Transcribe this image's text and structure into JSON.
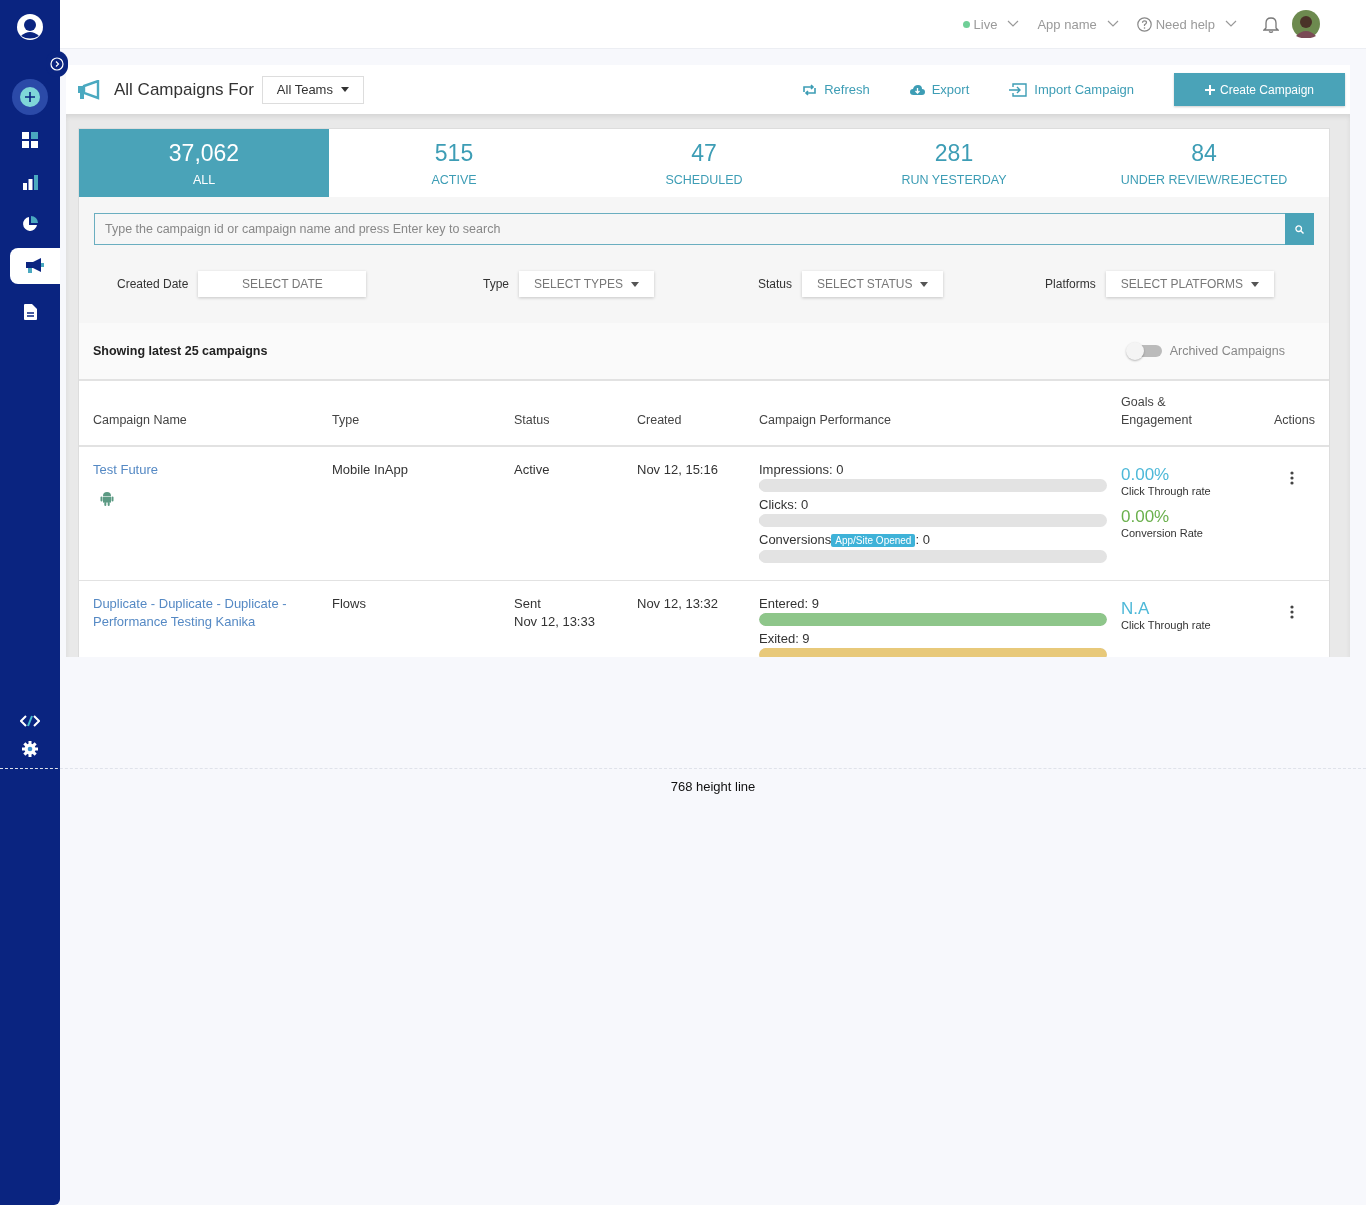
{
  "sidebar": {
    "items": [
      {
        "kind": "create",
        "selected": false
      },
      {
        "kind": "dashboard",
        "selected": false
      },
      {
        "kind": "analytics",
        "selected": false
      },
      {
        "kind": "segments",
        "selected": false
      },
      {
        "kind": "campaigns",
        "selected": true
      },
      {
        "kind": "reports",
        "selected": false
      }
    ],
    "bottom_items": [
      {
        "kind": "code"
      },
      {
        "kind": "settings"
      }
    ]
  },
  "header": {
    "environment": {
      "label": "Live",
      "color": "#6fcf97"
    },
    "app_name": "App name",
    "help": "Need help"
  },
  "title_bar": {
    "title": "All Campaigns For",
    "team_select": "All Teams",
    "actions": [
      {
        "kind": "refresh",
        "label": "Refresh"
      },
      {
        "kind": "export",
        "label": "Export"
      },
      {
        "kind": "import",
        "label": "Import Campaign"
      }
    ],
    "create_button": "Create Campaign"
  },
  "stats": [
    {
      "value": "37,062",
      "label": "ALL",
      "selected": true
    },
    {
      "value": "515",
      "label": "ACTIVE",
      "selected": false
    },
    {
      "value": "47",
      "label": "SCHEDULED",
      "selected": false
    },
    {
      "value": "281",
      "label": "RUN YESTERDAY",
      "selected": false
    },
    {
      "value": "84",
      "label": "UNDER REVIEW/REJECTED",
      "selected": false
    }
  ],
  "search": {
    "placeholder": "Type the campaign id or campaign name and press Enter key to search"
  },
  "filters": [
    {
      "label": "Created Date",
      "value": "SELECT DATE",
      "kind": "date"
    },
    {
      "label": "Type",
      "value": "SELECT TYPES",
      "kind": "dropdown"
    },
    {
      "label": "Status",
      "value": "SELECT STATUS",
      "kind": "dropdown"
    },
    {
      "label": "Platforms",
      "value": "SELECT PLATFORMS",
      "kind": "dropdown"
    }
  ],
  "summary": "Showing latest 25 campaigns",
  "archived_toggle": {
    "label": "Archived Campaigns",
    "on": false
  },
  "table": {
    "columns": [
      "Campaign Name",
      "Type",
      "Status",
      "Created",
      "Campaign Performance",
      "Goals & Engagement",
      "Actions"
    ],
    "rows": [
      {
        "name": "Test Future",
        "android_icon": true,
        "type": "Mobile InApp",
        "status": [
          "Active"
        ],
        "created": "Nov 12, 15:16",
        "metrics": [
          {
            "label": "Impressions: 0",
            "level": 0
          },
          {
            "label": "Clicks: 0",
            "level": 0
          },
          {
            "label": "Conversions",
            "badge": "App/Site Opened",
            "suffix": ": 0",
            "level": 0
          }
        ],
        "goals": [
          {
            "value": "0.00%",
            "label": "Click Through rate",
            "color": "#4db8d8"
          },
          {
            "value": "0.00%",
            "label": "Conversion Rate",
            "color": "#6ab04c"
          }
        ]
      },
      {
        "name": "Duplicate - Duplicate - Duplicate - Performance Testing Kanika",
        "type": "Flows",
        "status": [
          "Sent",
          "Nov 12, 13:33"
        ],
        "created": "Nov 12, 13:32",
        "metrics": [
          {
            "label": "Entered: 9",
            "level": 1,
            "color": "#8ec68a"
          },
          {
            "label": "Exited: 9",
            "level": 1,
            "color": "#e8c97a"
          }
        ],
        "goals": [
          {
            "value": "N.A",
            "label": "Click Through rate",
            "color": "#4db8d8"
          }
        ]
      }
    ]
  },
  "footer_note": "768 height line"
}
